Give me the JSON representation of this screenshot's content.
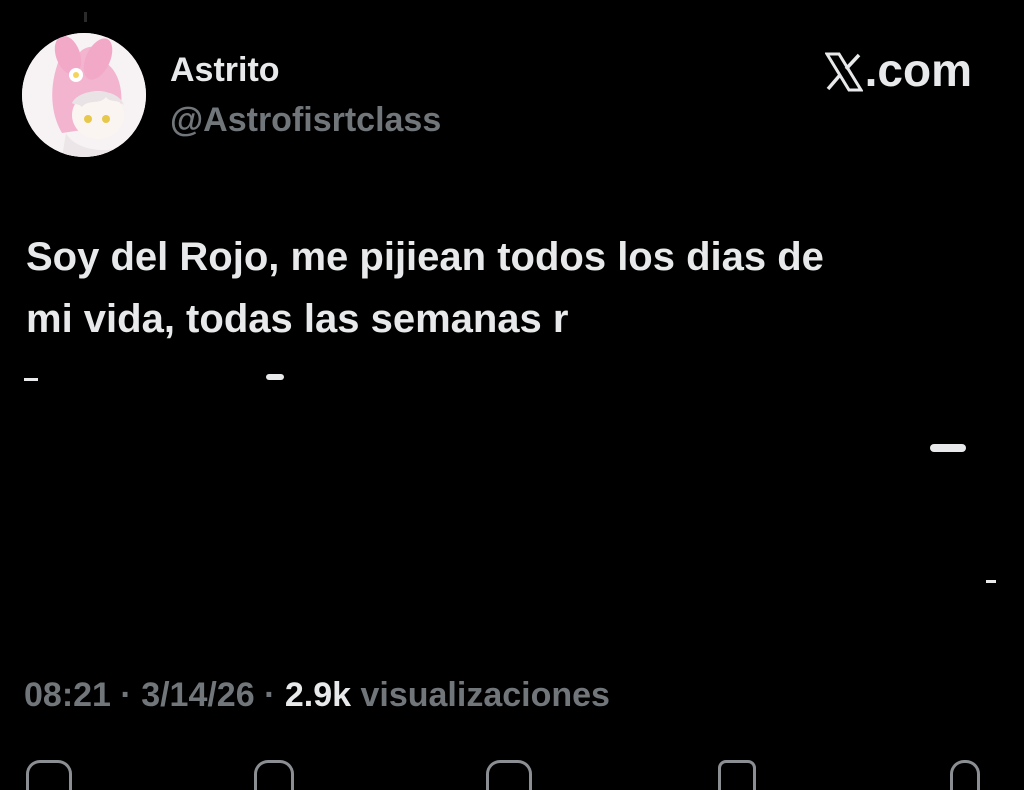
{
  "author": {
    "name": "Astrito",
    "handle": "@Astrofisrtclass"
  },
  "brand": {
    "label": ".com",
    "icon": "x-logo-icon"
  },
  "tweet": {
    "lines": [
      "Soy del Rojo, me pijiean todos los dias de",
      "mi vida, todas las semanas r"
    ]
  },
  "meta": {
    "time": "08:21",
    "separator1": " · ",
    "date": "3/14/26",
    "separator2": " · ",
    "views_count": "2.9k",
    "views_label": " visualizaciones"
  },
  "actions": {
    "icons": [
      "reply-icon",
      "retweet-icon",
      "like-icon",
      "bookmark-icon",
      "share-icon"
    ]
  },
  "colors": {
    "background": "#000000",
    "text_primary": "#e7e9ea",
    "text_secondary": "#71767b"
  }
}
